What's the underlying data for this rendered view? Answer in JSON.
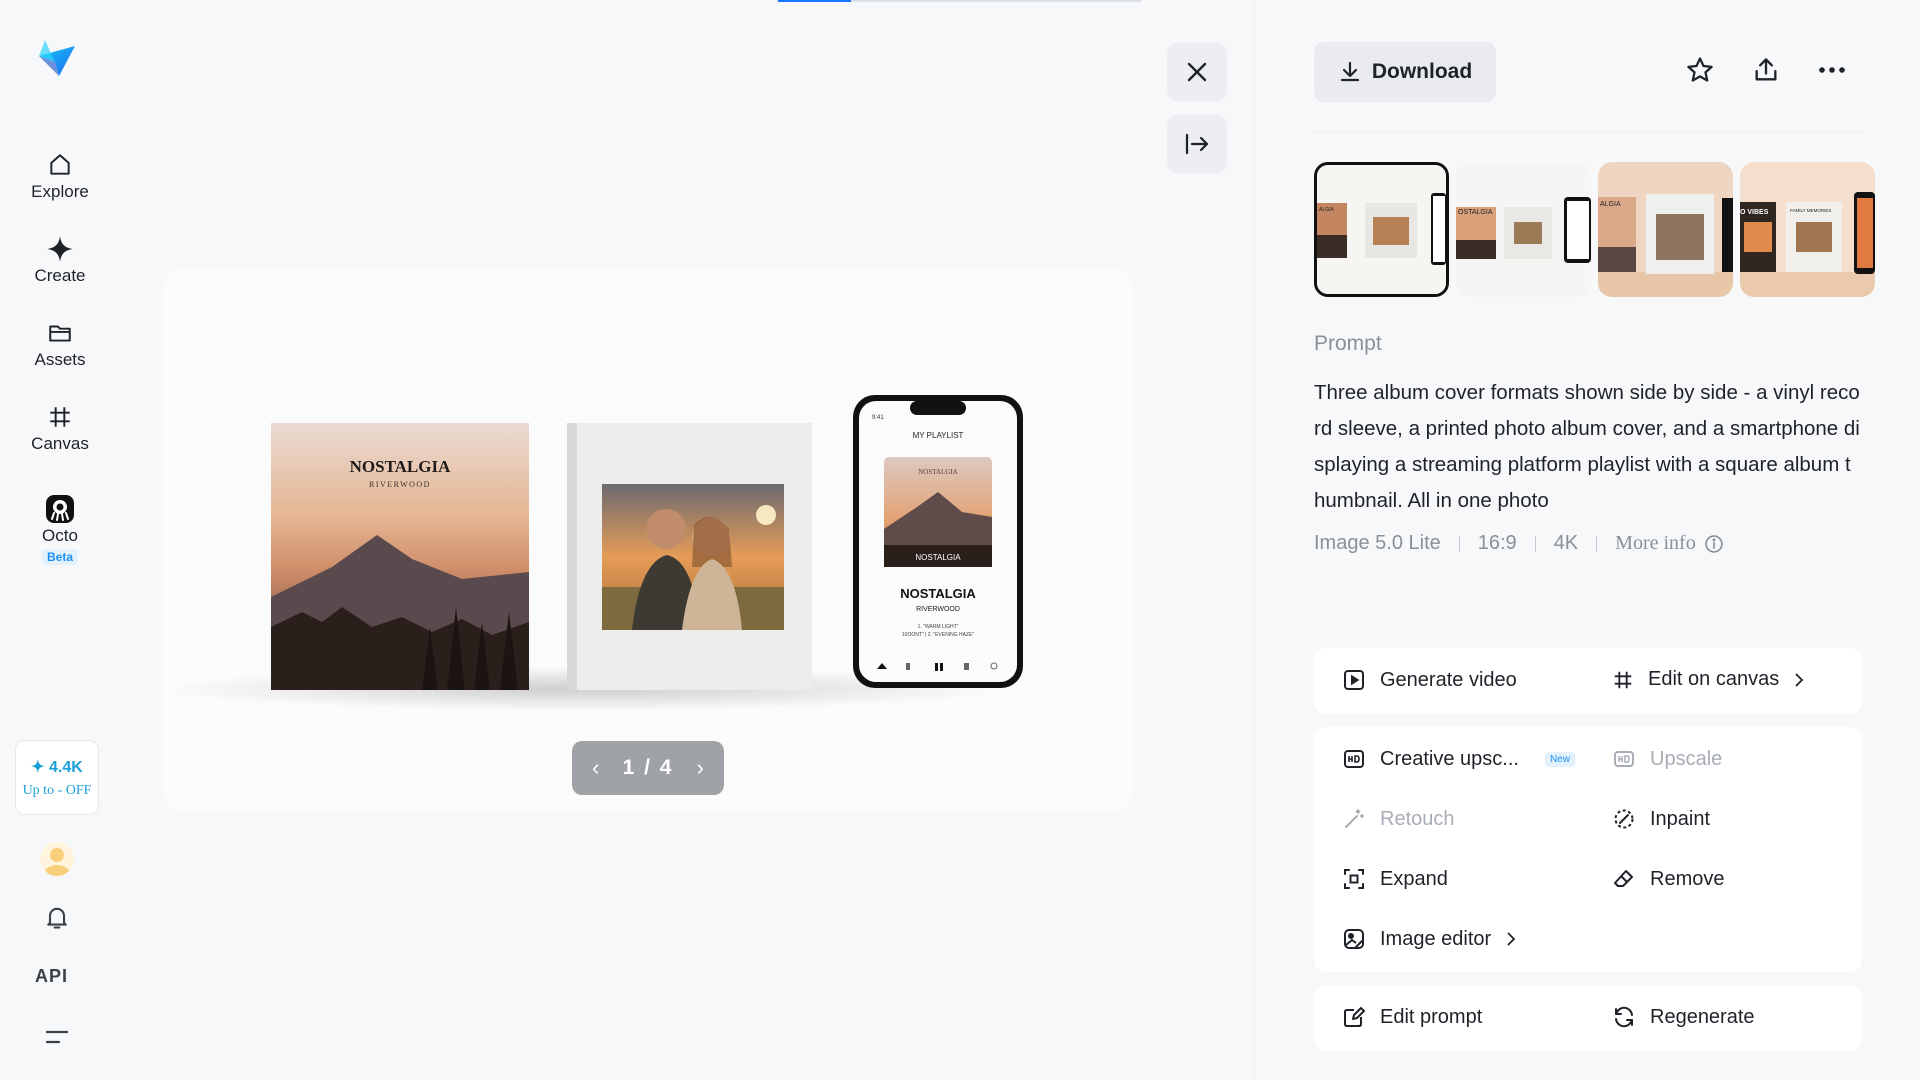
{
  "progress_fraction": 0.2,
  "sidebar": {
    "logo": "app-logo",
    "items": [
      {
        "label": "Explore",
        "icon": "home-icon"
      },
      {
        "label": "Create",
        "icon": "sparkle-icon"
      },
      {
        "label": "Assets",
        "icon": "folder-icon"
      },
      {
        "label": "Canvas",
        "icon": "frame-icon"
      },
      {
        "label": "Octo",
        "icon": "octo-icon",
        "badge": "Beta"
      }
    ],
    "credits": {
      "amount": "✦ 4.4K",
      "promo": "Up to - OFF"
    },
    "api_label": "API"
  },
  "viewer": {
    "page_indicator": "1 / 4",
    "mock": {
      "vinyl_title": "NOSTALGIA",
      "vinyl_sub": "RIVERWOOD",
      "phone_header": "MY PLAYLIST",
      "phone_time": "9:41",
      "phone_album_top": "NOSTALGIA",
      "phone_album_band": "NOSTALGIA",
      "phone_title": "NOSTALGIA",
      "phone_artist": "RIVERWOOD",
      "phone_track1": "1. \"WARM LIGHT\"",
      "phone_track2": "10OONT\" | 2. \"EVENING HAZE\""
    }
  },
  "panel": {
    "download_label": "Download",
    "thumb_texts": [
      "ALGIA",
      "OSTALGIA",
      "ALGIA",
      "O VIBES",
      "FAMILY MEMORIES"
    ],
    "prompt_heading": "Prompt",
    "prompt_text": "Three album cover formats shown side by side - a vinyl record sleeve, a printed photo album cover, and a smartphone displaying a streaming platform playlist with a square album thumbnail. All in one photo",
    "meta": {
      "model": "Image 5.0 Lite",
      "ratio": "16:9",
      "resolution": "4K",
      "more": "More info"
    },
    "actions": {
      "generate_video": "Generate video",
      "edit_on_canvas": "Edit on canvas",
      "creative_upscale": "Creative upsc...",
      "new_badge": "New",
      "upscale": "Upscale",
      "retouch": "Retouch",
      "inpaint": "Inpaint",
      "expand": "Expand",
      "remove": "Remove",
      "image_editor": "Image editor",
      "edit_prompt": "Edit prompt",
      "regenerate": "Regenerate"
    }
  }
}
